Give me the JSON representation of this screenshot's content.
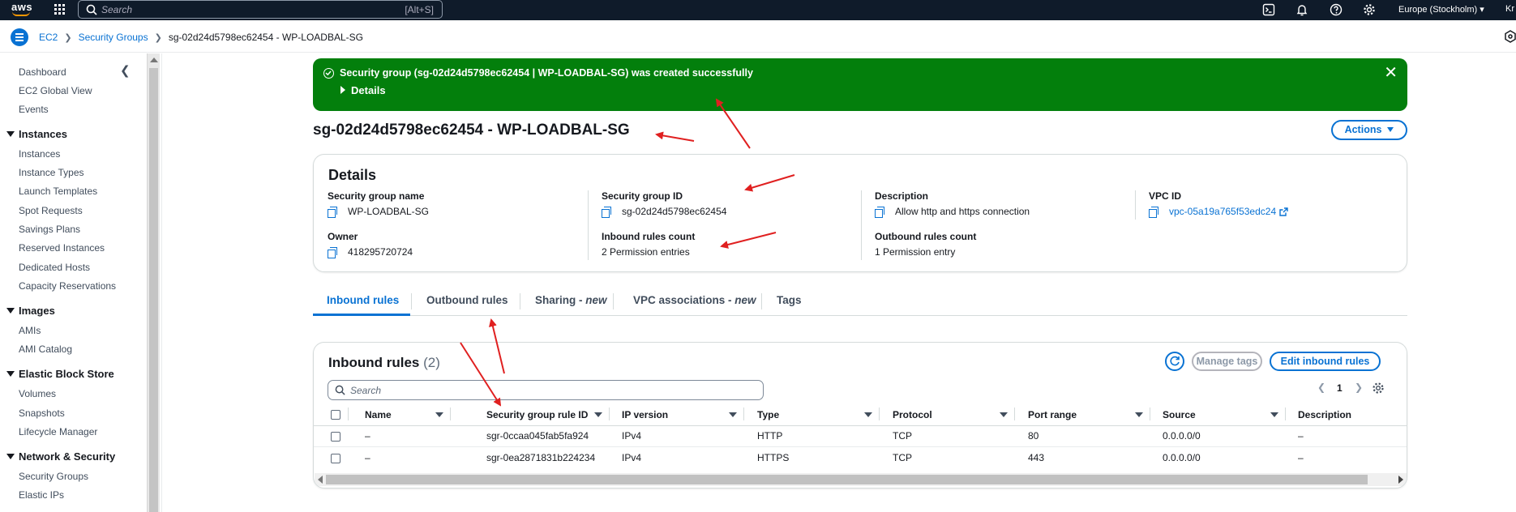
{
  "topbar": {
    "logo": "aws",
    "search_placeholder": "Search",
    "search_shortcut": "[Alt+S]",
    "region": "Europe (Stockholm)",
    "user_partial": "Kr",
    "icons": [
      "apps-grid-icon",
      "cloudshell-icon",
      "bell-icon",
      "help-icon",
      "gear-icon"
    ]
  },
  "breadcrumb": {
    "items": [
      "EC2",
      "Security Groups"
    ],
    "current": "sg-02d24d5798ec62454 - WP-LOADBAL-SG"
  },
  "sidebar": {
    "top_items": [
      "Dashboard",
      "EC2 Global View",
      "Events"
    ],
    "sections": [
      {
        "title": "Instances",
        "items": [
          "Instances",
          "Instance Types",
          "Launch Templates",
          "Spot Requests",
          "Savings Plans",
          "Reserved Instances",
          "Dedicated Hosts",
          "Capacity Reservations"
        ]
      },
      {
        "title": "Images",
        "items": [
          "AMIs",
          "AMI Catalog"
        ]
      },
      {
        "title": "Elastic Block Store",
        "items": [
          "Volumes",
          "Snapshots",
          "Lifecycle Manager"
        ]
      },
      {
        "title": "Network & Security",
        "items": [
          "Security Groups",
          "Elastic IPs"
        ]
      }
    ]
  },
  "flash": {
    "prefix": "Security group (",
    "link": "sg-02d24d5798ec62454 | WP-LOADBAL-SG",
    "suffix": ") was created successfully",
    "details": "Details",
    "color": "#037f0c"
  },
  "page": {
    "title": "sg-02d24d5798ec62454 - WP-LOADBAL-SG",
    "actions_label": "Actions"
  },
  "details": {
    "title": "Details",
    "sg_name_label": "Security group name",
    "sg_name": "WP-LOADBAL-SG",
    "sg_id_label": "Security group ID",
    "sg_id": "sg-02d24d5798ec62454",
    "description_label": "Description",
    "description": "Allow http and https connection",
    "vpc_label": "VPC ID",
    "vpc_id": "vpc-05a19a765f53edc24",
    "owner_label": "Owner",
    "owner": "418295720724",
    "inbound_count_label": "Inbound rules count",
    "inbound_count": "2 Permission entries",
    "outbound_count_label": "Outbound rules count",
    "outbound_count": "1 Permission entry"
  },
  "tabs": {
    "inbound": "Inbound rules",
    "outbound": "Outbound rules",
    "sharing": "Sharing - ",
    "sharing_new": "new",
    "vpc_assoc": "VPC associations - ",
    "vpc_new": "new",
    "tags": "Tags"
  },
  "inbound": {
    "title": "Inbound rules",
    "count": "(2)",
    "manage_tags": "Manage tags",
    "edit": "Edit inbound rules",
    "search_placeholder": "Search",
    "page": "1",
    "columns": [
      "Name",
      "Security group rule ID",
      "IP version",
      "Type",
      "Protocol",
      "Port range",
      "Source",
      "Description"
    ],
    "rows": [
      [
        "–",
        "sgr-0ccaa045fab5fa924",
        "IPv4",
        "HTTP",
        "TCP",
        "80",
        "0.0.0.0/0",
        "–"
      ],
      [
        "–",
        "sgr-0ea2871831b224234",
        "IPv4",
        "HTTPS",
        "TCP",
        "443",
        "0.0.0.0/0",
        "–"
      ]
    ]
  },
  "annotation_color": "#e02020"
}
